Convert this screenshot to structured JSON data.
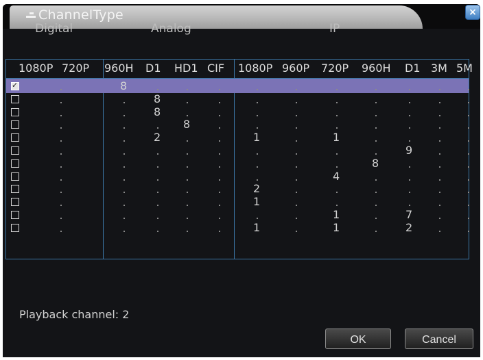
{
  "window": {
    "title": "ChannelType",
    "close_label": "×"
  },
  "groups": [
    "Digital",
    "Analog",
    "IP"
  ],
  "columns": [
    "1080P",
    "720P",
    "960H",
    "D1",
    "HD1",
    "CIF",
    "1080P",
    "960P",
    "720P",
    "960H",
    "D1",
    "3M",
    "5M"
  ],
  "rows": [
    {
      "checked": true,
      "values": [
        "",
        "",
        "8",
        "",
        "",
        "",
        "",
        "",
        "",
        "",
        "",
        "",
        ""
      ]
    },
    {
      "checked": false,
      "values": [
        "",
        "",
        "",
        "8",
        "",
        "",
        "",
        "",
        "",
        "",
        "",
        "",
        ""
      ]
    },
    {
      "checked": false,
      "values": [
        "",
        "",
        "",
        "8",
        "",
        "",
        "",
        "",
        "",
        "",
        "",
        "",
        ""
      ]
    },
    {
      "checked": false,
      "values": [
        "",
        "",
        "",
        "",
        "8",
        "",
        "",
        "",
        "",
        "",
        "",
        "",
        ""
      ]
    },
    {
      "checked": false,
      "values": [
        "",
        "",
        "",
        "2",
        "",
        "",
        "1",
        "",
        "1",
        "",
        "",
        "",
        ""
      ]
    },
    {
      "checked": false,
      "values": [
        "",
        "",
        "",
        "",
        "",
        "",
        "",
        "",
        "",
        "",
        "9",
        "",
        ""
      ]
    },
    {
      "checked": false,
      "values": [
        "",
        "",
        "",
        "",
        "",
        "",
        "",
        "",
        "",
        "8",
        "",
        "",
        ""
      ]
    },
    {
      "checked": false,
      "values": [
        "",
        "",
        "",
        "",
        "",
        "",
        "",
        "",
        "4",
        "",
        "",
        "",
        ""
      ]
    },
    {
      "checked": false,
      "values": [
        "",
        "",
        "",
        "",
        "",
        "",
        "2",
        "",
        "",
        "",
        "",
        "",
        ""
      ]
    },
    {
      "checked": false,
      "values": [
        "",
        "",
        "",
        "",
        "",
        "",
        "1",
        "",
        "",
        "",
        "",
        "",
        ""
      ]
    },
    {
      "checked": false,
      "values": [
        "",
        "",
        "",
        "",
        "",
        "",
        "",
        "",
        "1",
        "",
        "7",
        "",
        ""
      ]
    },
    {
      "checked": false,
      "values": [
        "",
        "",
        "",
        "",
        "",
        "",
        "1",
        "",
        "1",
        "",
        "2",
        "",
        ""
      ]
    }
  ],
  "footer": {
    "playback_label": "Playback channel: 2"
  },
  "buttons": {
    "ok": "OK",
    "cancel": "Cancel"
  }
}
